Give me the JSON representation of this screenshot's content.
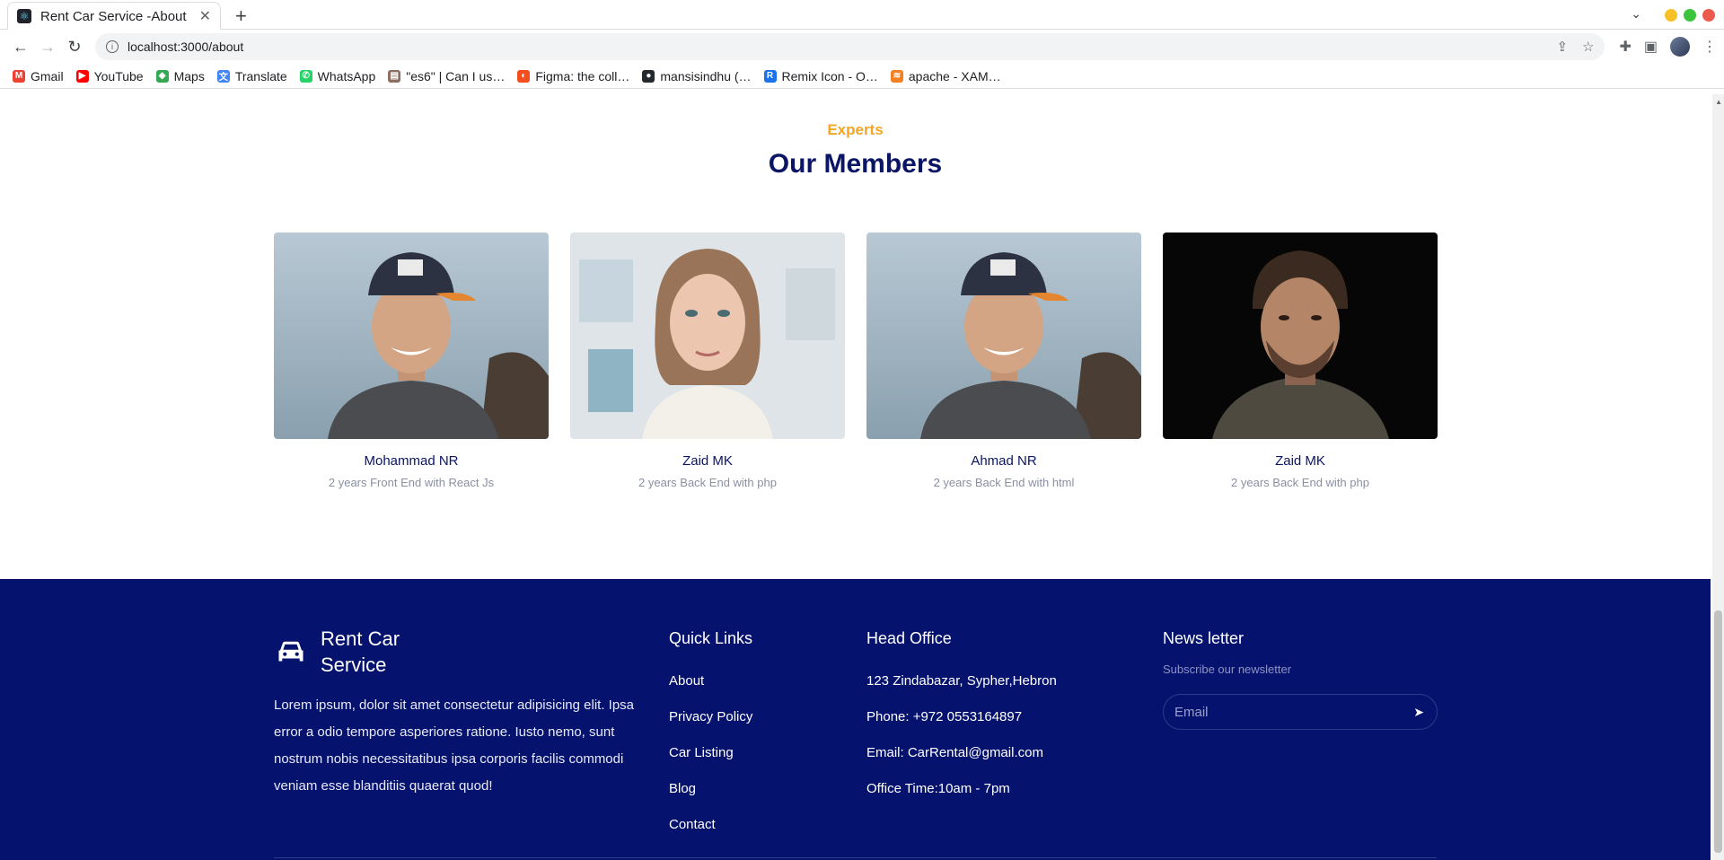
{
  "browser": {
    "tab_title": "Rent Car Service -About",
    "tab_close": "✕",
    "new_tab": "+",
    "url": "localhost:3000/about",
    "bookmarks": [
      {
        "label": "Gmail",
        "color": "#ea4335",
        "glyph": "M"
      },
      {
        "label": "YouTube",
        "color": "#ff0000",
        "glyph": "▶"
      },
      {
        "label": "Maps",
        "color": "#34a853",
        "glyph": "◆"
      },
      {
        "label": "Translate",
        "color": "#4285f4",
        "glyph": "文"
      },
      {
        "label": "WhatsApp",
        "color": "#25d366",
        "glyph": "✆"
      },
      {
        "label": "\"es6\" | Can I us…",
        "color": "#8d6e63",
        "glyph": "▤"
      },
      {
        "label": "Figma: the coll…",
        "color": "#f24e1e",
        "glyph": "◐"
      },
      {
        "label": "mansisindhu (…",
        "color": "#24292e",
        "glyph": "●"
      },
      {
        "label": "Remix Icon - O…",
        "color": "#1a73e8",
        "glyph": "R"
      },
      {
        "label": "apache - XAM…",
        "color": "#f48024",
        "glyph": "≋"
      }
    ]
  },
  "members_section": {
    "eyebrow": "Experts",
    "title": "Our Members",
    "members": [
      {
        "name": "Mohammad NR",
        "role": "2 years Front End with React Js"
      },
      {
        "name": "Zaid MK",
        "role": "2 years Back End with php"
      },
      {
        "name": "Ahmad NR",
        "role": "2 years Back End with html"
      },
      {
        "name": "Zaid MK",
        "role": "2 years Back End with php"
      }
    ]
  },
  "footer": {
    "brand": "Rent Car Service",
    "description": "Lorem ipsum, dolor sit amet consectetur adipisicing elit. Ipsa error a odio tempore asperiores ratione. Iusto nemo, sunt nostrum nobis necessitatibus ipsa corporis facilis commodi veniam esse blanditiis quaerat quod!",
    "quick_links_title": "Quick Links",
    "quick_links": [
      "About",
      "Privacy Policy",
      "Car Listing",
      "Blog",
      "Contact"
    ],
    "head_office_title": "Head Office",
    "office": [
      "123 Zindabazar, Sypher,Hebron",
      "Phone: +972 0553164897",
      "Email: CarRental@gmail.com",
      "Office Time:10am - 7pm"
    ],
    "newsletter_title": "News letter",
    "newsletter_sub": "Subscribe our newsletter",
    "email_placeholder": "Email"
  },
  "colors": {
    "navy": "#06136e",
    "accent": "#f5a623",
    "title": "#0a1565"
  }
}
